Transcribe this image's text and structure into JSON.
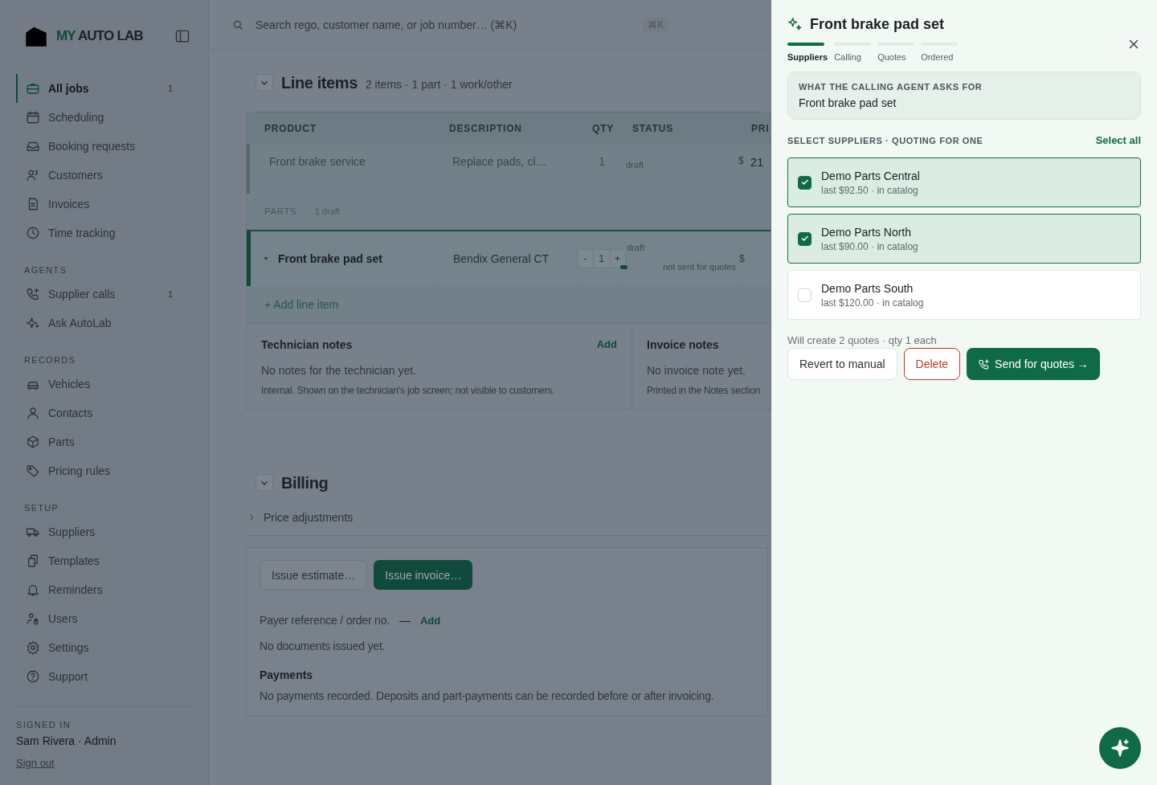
{
  "sidebar": {
    "brand_accent": "MY",
    "brand": "AUTO LAB",
    "sections": [
      {
        "items": [
          {
            "label": "All jobs",
            "count": "1",
            "selected": true
          },
          {
            "label": "Scheduling",
            "selected": false
          },
          {
            "label": "Booking requests",
            "selected": false
          },
          {
            "label": "Customers",
            "selected": false
          },
          {
            "label": "Invoices",
            "selected": false
          },
          {
            "label": "Time tracking",
            "selected": false
          }
        ]
      },
      {
        "heading": "AGENTS",
        "items": [
          {
            "label": "Supplier calls",
            "count": "1",
            "selected": false
          },
          {
            "label": "Ask AutoLab",
            "selected": false
          }
        ]
      },
      {
        "heading": "RECORDS",
        "items": [
          {
            "label": "Vehicles",
            "selected": false
          },
          {
            "label": "Contacts",
            "selected": false
          },
          {
            "label": "Parts",
            "selected": false
          },
          {
            "label": "Pricing rules",
            "selected": false
          }
        ]
      },
      {
        "heading": "SETUP",
        "items": [
          {
            "label": "Suppliers",
            "selected": false
          },
          {
            "label": "Templates",
            "selected": false
          },
          {
            "label": "Reminders",
            "selected": false
          },
          {
            "label": "Users",
            "selected": false
          },
          {
            "label": "Settings",
            "selected": false
          },
          {
            "label": "Support",
            "selected": false
          }
        ]
      }
    ],
    "user": {
      "heading": "SIGNED IN",
      "name": "Sam Rivera · Admin",
      "link": "Sign out"
    }
  },
  "search": {
    "placeholder": "Search rego, customer name, or job number… (⌘K)",
    "shortcut": "⌘K"
  },
  "line_items": {
    "title": "Line items",
    "summary": "2 items · 1 part · 1 work/other",
    "expanded": true,
    "columns": [
      "PRODUCT",
      "DESCRIPTION",
      "QTY",
      "STATUS",
      "PRI"
    ],
    "rows": [
      {
        "kind": "work",
        "product": "Front brake service",
        "description": "Replace pads, cl…",
        "qty": "1",
        "status": "draft",
        "currency": "$",
        "price": "21",
        "selected": false
      }
    ],
    "group": {
      "label": "PARTS",
      "count": "1 draft"
    },
    "parts": [
      {
        "kind": "part",
        "product": "Front brake pad set",
        "description": "Bendix General CT",
        "qty": "1",
        "minus": "-",
        "plus": "+",
        "status": "draft",
        "note": "not sent for quotes",
        "currency": "$",
        "expanded": true,
        "selected": true
      }
    ],
    "add_label": "+ Add line item"
  },
  "notes": [
    {
      "title": "Technician notes",
      "action": "Add",
      "text": "No notes for the technician yet.",
      "hint": "Internal. Shown on the technician's job screen; not visible to customers."
    },
    {
      "title": "Invoice notes",
      "text": "No invoice note yet.",
      "hint": "Printed in the Notes section"
    }
  ],
  "billing": {
    "title": "Billing",
    "expanded": true,
    "adjustments": {
      "label": "Price adjustments",
      "expanded": false
    },
    "buttons": [
      {
        "label": "Issue estimate…",
        "kind": "secondary"
      },
      {
        "label": "Issue invoice…",
        "kind": "primary"
      }
    ],
    "payer": {
      "label": "Payer reference / order no.",
      "value": "—",
      "action": "Add"
    },
    "documents": "No documents issued yet.",
    "payments_title": "Payments",
    "payments_text": "No payments recorded. Deposits and part-payments can be recorded before or after invoicing."
  },
  "drawer": {
    "title": "Front brake pad set",
    "steps": [
      {
        "label": "Suppliers",
        "selected": true
      },
      {
        "label": "Calling",
        "selected": false
      },
      {
        "label": "Quotes",
        "selected": false
      },
      {
        "label": "Ordered",
        "selected": false
      }
    ],
    "request": {
      "label": "WHAT THE CALLING AGENT ASKS FOR",
      "value": "Front brake pad set"
    },
    "suppliers_heading": "SELECT SUPPLIERS · QUOTING FOR ONE",
    "select_all": "Select all",
    "suppliers": [
      {
        "name": "Demo Parts Central",
        "detail": "last $92.50 · in catalog",
        "checked": true
      },
      {
        "name": "Demo Parts North",
        "detail": "last $90.00 · in catalog",
        "checked": true
      },
      {
        "name": "Demo Parts South",
        "detail": "last $120.00 · in catalog",
        "checked": false
      }
    ],
    "summary": "Will create 2 quotes · qty 1 each",
    "buttons": [
      {
        "label": "Revert to manual",
        "kind": "secondary"
      },
      {
        "label": "Delete",
        "kind": "danger"
      },
      {
        "label": "Send for quotes →",
        "kind": "primary"
      }
    ]
  }
}
